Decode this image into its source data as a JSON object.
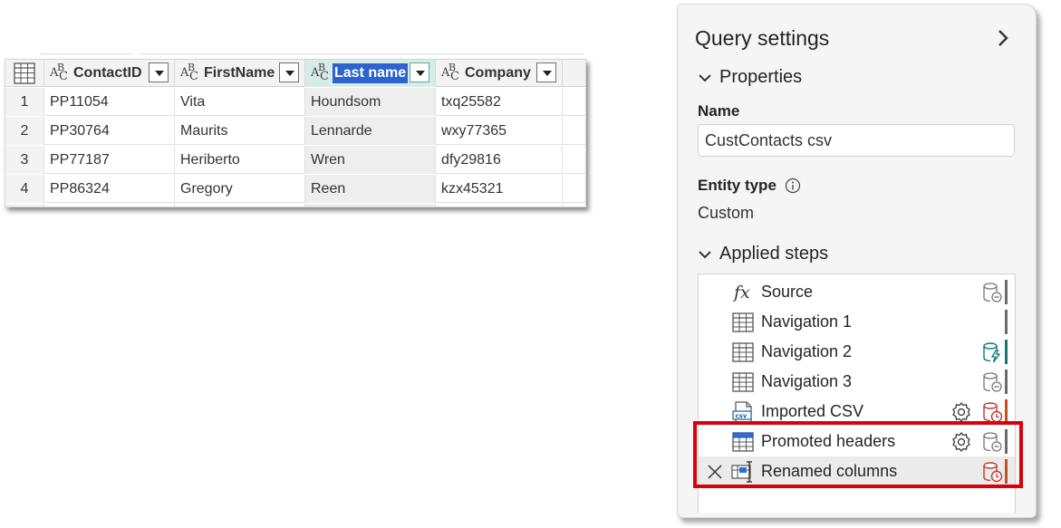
{
  "grid": {
    "columns": [
      {
        "type_icon": "AB-C",
        "name": "ContactID"
      },
      {
        "type_icon": "AB-C",
        "name": "FirstName"
      },
      {
        "type_icon": "AB-C",
        "name": "Last name"
      },
      {
        "type_icon": "AB-C",
        "name": "Company"
      }
    ],
    "rows": [
      {
        "num": "1",
        "cells": [
          "PP11054",
          "Vita",
          "Houndsom",
          "txq25582"
        ]
      },
      {
        "num": "2",
        "cells": [
          "PP30764",
          "Maurits",
          "Lennarde",
          "wxy77365"
        ]
      },
      {
        "num": "3",
        "cells": [
          "PP77187",
          "Heriberto",
          "Wren",
          "dfy29816"
        ]
      },
      {
        "num": "4",
        "cells": [
          "PP86324",
          "Gregory",
          "Reen",
          "kzx45321"
        ]
      }
    ],
    "selected_column": "Last name"
  },
  "panel": {
    "title": "Query settings",
    "properties_label": "Properties",
    "name_label": "Name",
    "name_value": "CustContacts csv",
    "entity_type_label": "Entity type",
    "entity_type_value": "Custom",
    "applied_steps_label": "Applied steps",
    "steps": [
      {
        "label": "Source",
        "icon": "fx-icon",
        "gear": false,
        "db": "database-gray-icon",
        "bar_color": "#6b6b6b"
      },
      {
        "label": "Navigation 1",
        "icon": "table-icon",
        "gear": false,
        "db": "",
        "bar_color": "#6b6b6b"
      },
      {
        "label": "Navigation 2",
        "icon": "table-icon",
        "gear": false,
        "db": "database-lightning-teal-icon",
        "bar_color": "#0b7a75"
      },
      {
        "label": "Navigation 3",
        "icon": "table-icon",
        "gear": false,
        "db": "database-gray-icon",
        "bar_color": "#6b6b6b"
      },
      {
        "label": "Imported CSV",
        "icon": "csv-file-icon",
        "gear": true,
        "db": "database-clock-red-icon",
        "bar_color": "#c4501d"
      },
      {
        "label": "Promoted headers",
        "icon": "table-blue-header-icon",
        "gear": true,
        "db": "database-gray-icon",
        "bar_color": "#6b6b6b"
      },
      {
        "label": "Renamed columns",
        "icon": "rename-columns-icon",
        "gear": false,
        "db": "database-clock-red-icon",
        "bar_color": "#c4501d"
      }
    ]
  }
}
